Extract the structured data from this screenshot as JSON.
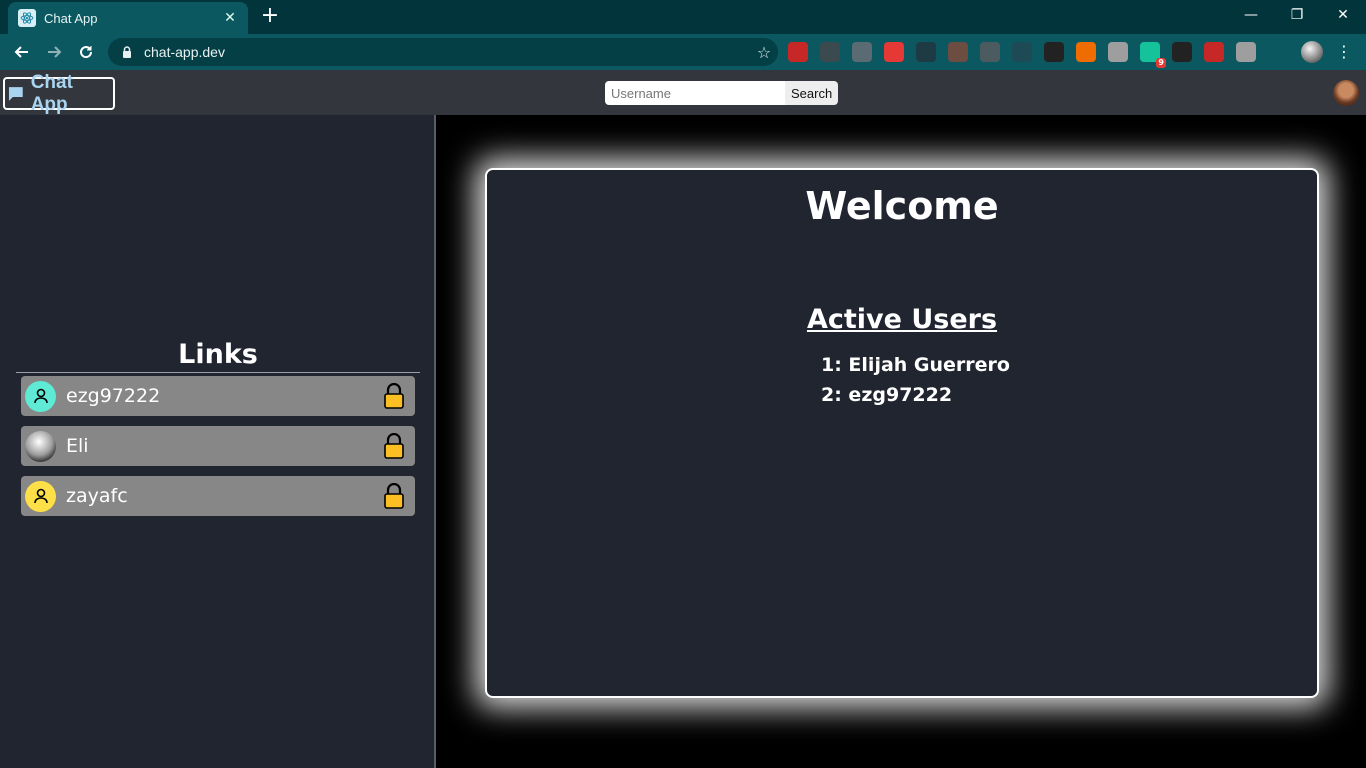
{
  "browser": {
    "tab_title": "Chat App",
    "url": "chat-app.dev",
    "extensions": [
      {
        "icon": "ext-red-icon",
        "color": "#c62828"
      },
      {
        "icon": "ext-t-icon",
        "color": "#3a4a4f"
      },
      {
        "icon": "ext-facebook-icon",
        "color": "#5b6b73"
      },
      {
        "icon": "ext-stop-hand-icon",
        "color": "#e53935"
      },
      {
        "icon": "ext-react-icon",
        "color": "#1e3a44"
      },
      {
        "icon": "ext-cookie-icon",
        "color": "#6d4c41"
      },
      {
        "icon": "ext-box-icon",
        "color": "#4b5b60"
      },
      {
        "icon": "ext-lt-icon",
        "color": "#1e4a55"
      },
      {
        "icon": "ext-github-icon",
        "color": "#222222"
      },
      {
        "icon": "ext-capsule-icon",
        "color": "#ef6c00"
      },
      {
        "icon": "ext-check-icon",
        "color": "#9e9e9e"
      },
      {
        "icon": "ext-grammarly-icon",
        "color": "#15c39a",
        "badge": "9"
      },
      {
        "icon": "ext-w-icon",
        "color": "#222222"
      },
      {
        "icon": "ext-av-icon",
        "color": "#c62828"
      },
      {
        "icon": "ext-r-icon",
        "color": "#9e9e9e"
      },
      {
        "icon": "puzzle-icon",
        "color": "#0c5860"
      }
    ]
  },
  "app": {
    "brand": "Chat App",
    "search": {
      "placeholder": "Username",
      "button": "Search"
    }
  },
  "sidebar": {
    "title": "Links",
    "items": [
      {
        "name": "ezg97222",
        "avatar_color": "#5eead4"
      },
      {
        "name": "Eli",
        "avatar_color": "#9e9e9e"
      },
      {
        "name": "zayafc",
        "avatar_color": "#fde047"
      }
    ]
  },
  "main": {
    "welcome": "Welcome",
    "active_users_title": "Active Users",
    "active_users": [
      "1: Elijah Guerrero",
      "2: ezg97222"
    ]
  },
  "colors": {
    "brand_text": "#a9d4ef",
    "sidebar_bg": "#212530",
    "link_item_bg": "#878787",
    "lock": "#fbbf24"
  }
}
